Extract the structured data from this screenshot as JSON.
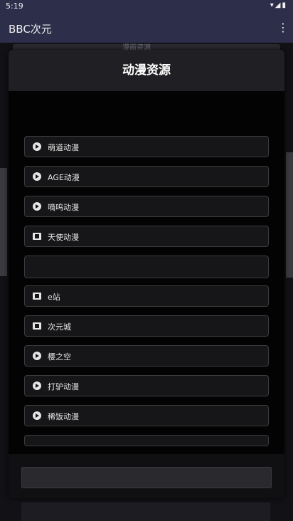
{
  "status": {
    "time": "5:19",
    "icons": "▾◢▮"
  },
  "appbar": {
    "title": "BBC次元",
    "overflow_icon": "more-vert-icon"
  },
  "background": {
    "peek_text": "漫画资源"
  },
  "dialog": {
    "title": "动漫资源",
    "items": [
      {
        "label": "萌道动漫",
        "icon": "play-circle-icon"
      },
      {
        "label": "AGE动漫",
        "icon": "play-circle-icon"
      },
      {
        "label": "嘀呜动漫",
        "icon": "play-circle-icon"
      },
      {
        "label": "天使动漫",
        "icon": "film-icon"
      },
      {
        "label": "",
        "icon": ""
      },
      {
        "label": "e站",
        "icon": "film-icon"
      },
      {
        "label": "次元城",
        "icon": "film-icon"
      },
      {
        "label": "樱之空",
        "icon": "play-circle-icon"
      },
      {
        "label": "打驴动漫",
        "icon": "play-circle-icon"
      },
      {
        "label": "稀饭动漫",
        "icon": "play-circle-icon"
      },
      {
        "label": "",
        "icon": ""
      }
    ]
  }
}
